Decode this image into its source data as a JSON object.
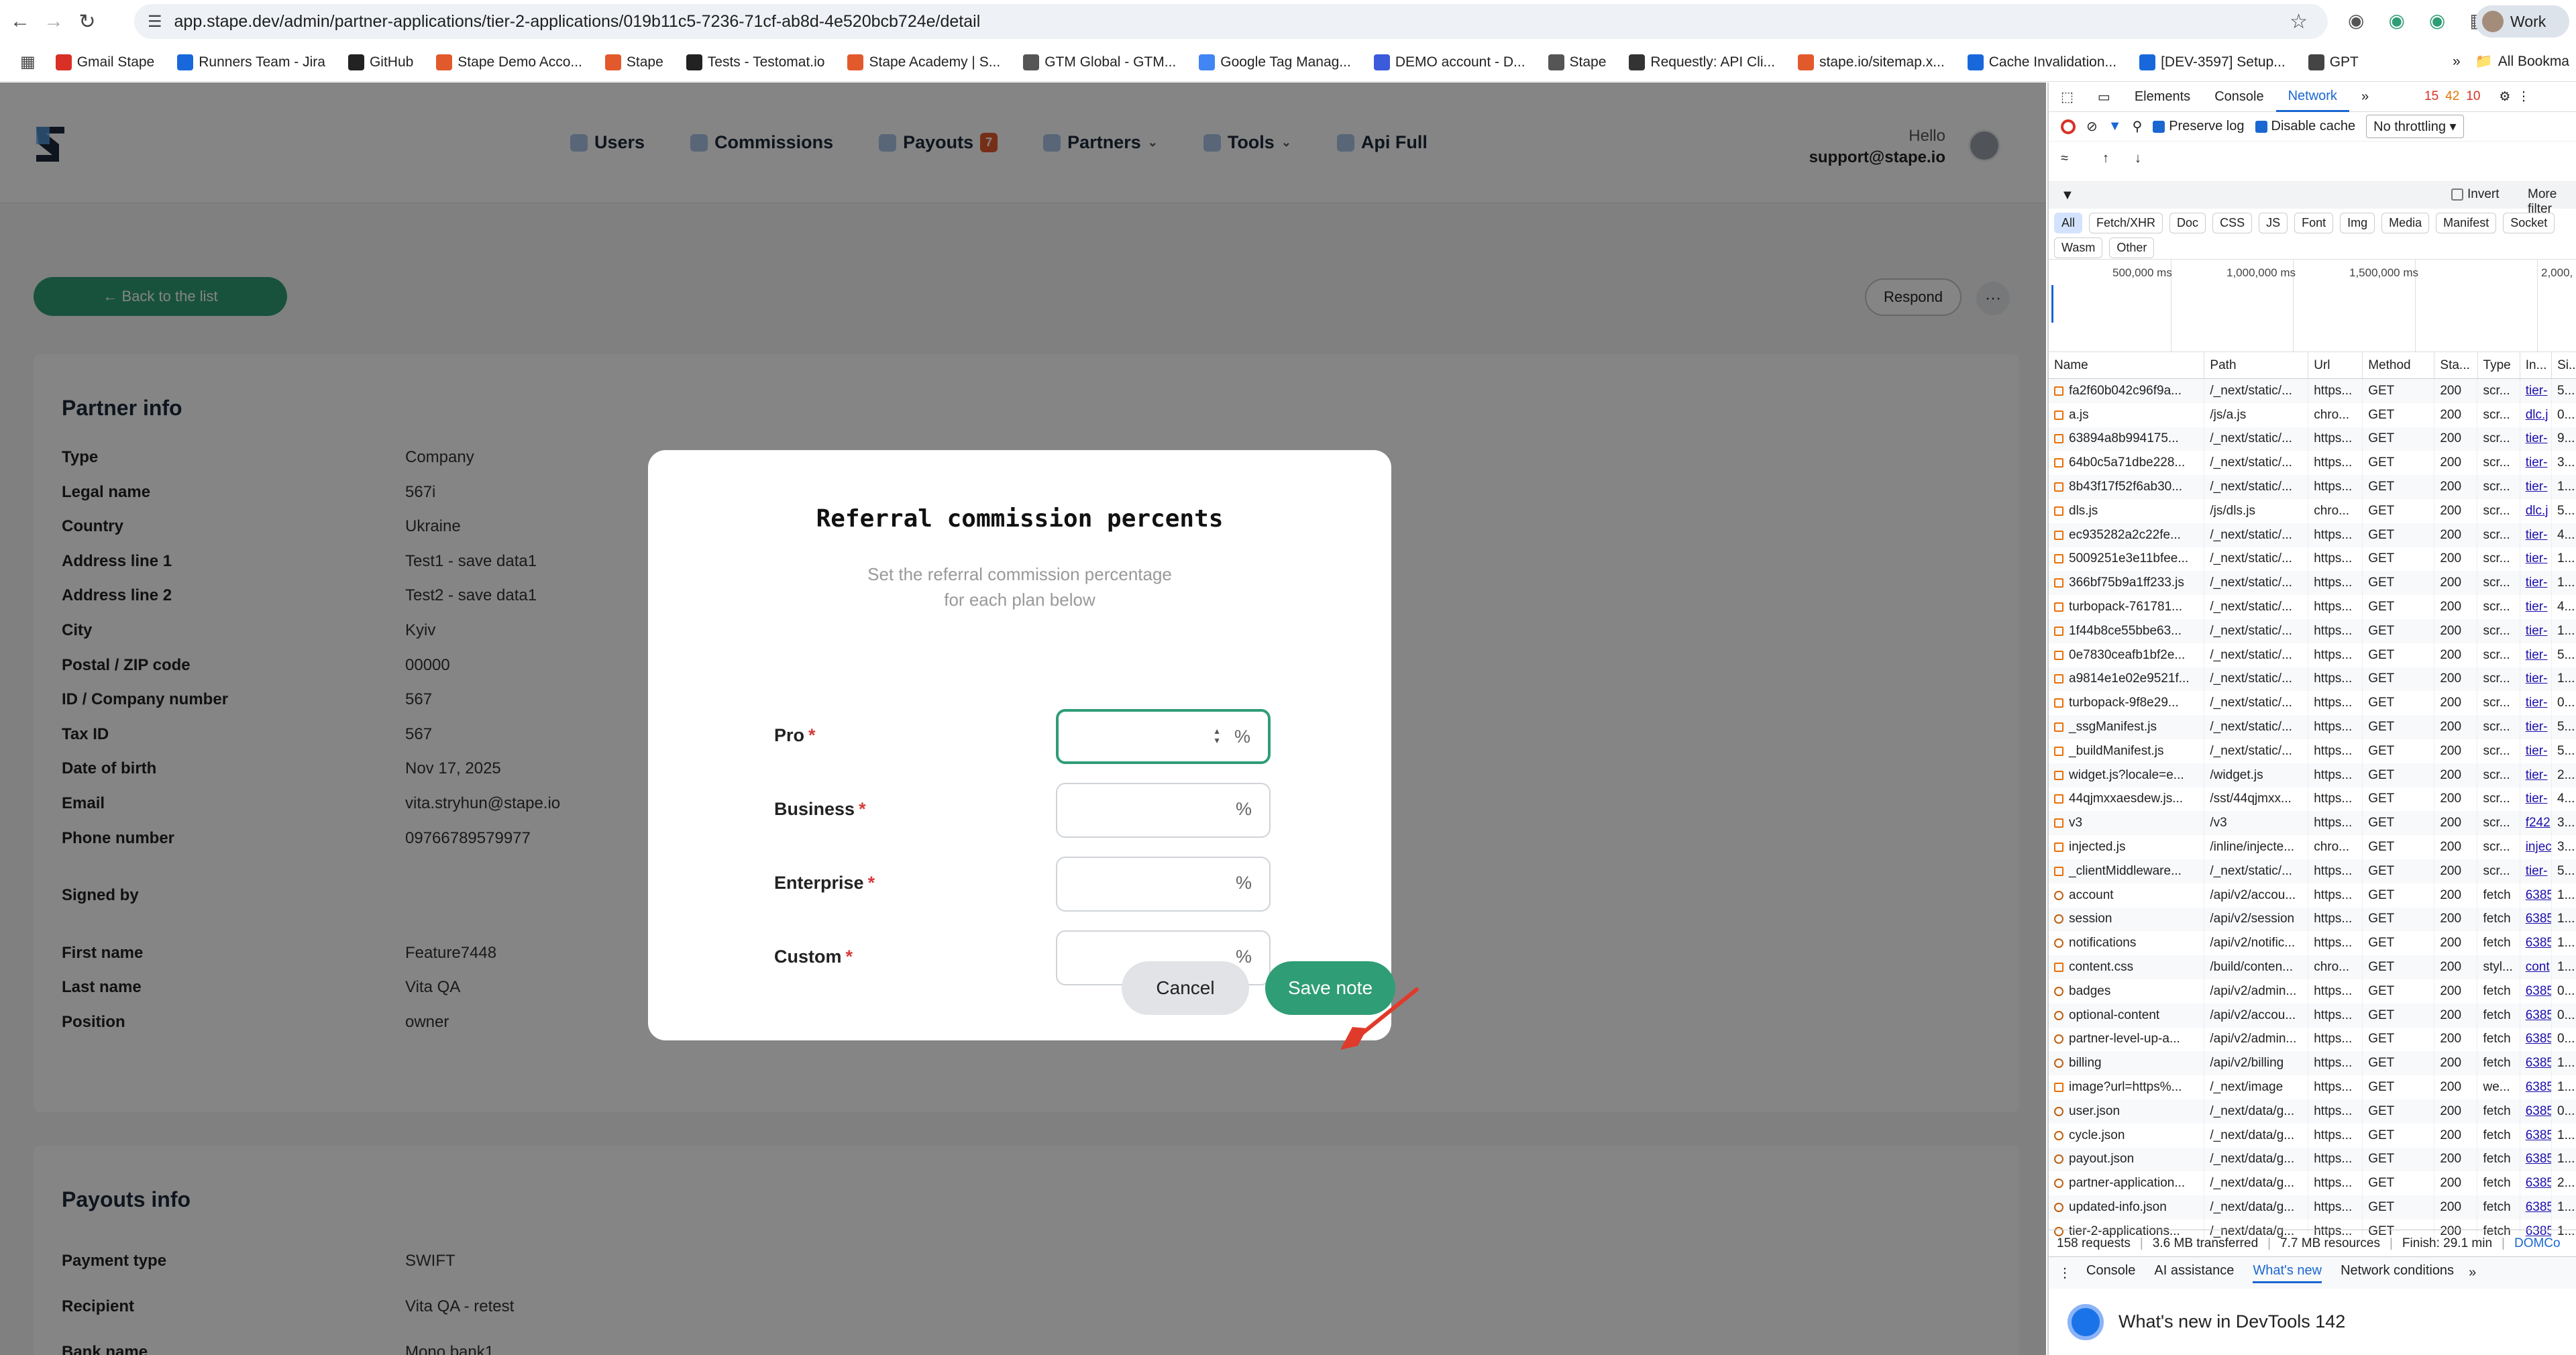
{
  "browser": {
    "url": "app.stape.dev/admin/partner-applications/tier-2-applications/019b11c5-7236-71cf-ab8d-4e520bcb724e/detail",
    "profile": "Work",
    "bookmarks": [
      {
        "label": "Gmail Stape",
        "icon": "gmail-icon",
        "color": "#d93025"
      },
      {
        "label": "Runners Team - Jira",
        "icon": "jira-icon",
        "color": "#1868db"
      },
      {
        "label": "GitHub",
        "icon": "github-icon",
        "color": "#222222"
      },
      {
        "label": "Stape Demo Acco...",
        "icon": "stape-icon",
        "color": "#e25a2c"
      },
      {
        "label": "Stape",
        "icon": "stape-icon",
        "color": "#e25a2c"
      },
      {
        "label": "Tests - Testomat.io",
        "icon": "testomat-icon",
        "color": "#222222"
      },
      {
        "label": "Stape Academy | S...",
        "icon": "stape-icon",
        "color": "#e25a2c"
      },
      {
        "label": "GTM Global - GTM...",
        "icon": "globe-icon",
        "color": "#555555"
      },
      {
        "label": "Google Tag Manag...",
        "icon": "gtm-icon",
        "color": "#4285f4"
      },
      {
        "label": "DEMO account - D...",
        "icon": "demo-icon",
        "color": "#3b5bdb"
      },
      {
        "label": "Stape",
        "icon": "globe-icon",
        "color": "#555555"
      },
      {
        "label": "Requestly: API Cli...",
        "icon": "requestly-icon",
        "color": "#333333"
      },
      {
        "label": "stape.io/sitemap.x...",
        "icon": "stape-icon",
        "color": "#e25a2c"
      },
      {
        "label": "Cache Invalidation...",
        "icon": "cache-icon",
        "color": "#1868db"
      },
      {
        "label": "[DEV-3597] Setup...",
        "icon": "jira-icon",
        "color": "#1868db"
      },
      {
        "label": "GPT",
        "icon": "gpt-icon",
        "color": "#444444"
      }
    ],
    "all_bookmarks": "All Bookma"
  },
  "app": {
    "nav": [
      {
        "label": "Users",
        "dropdown": false
      },
      {
        "label": "Commissions",
        "dropdown": false
      },
      {
        "label": "Payouts",
        "badge": "7",
        "dropdown": false
      },
      {
        "label": "Partners",
        "dropdown": true
      },
      {
        "label": "Tools",
        "dropdown": true
      },
      {
        "label": "Api Full",
        "dropdown": false
      }
    ],
    "hello": "Hello",
    "user_email": "support@stape.io",
    "back_label": "← Back to the list",
    "respond_label": "Respond",
    "more_label": "···"
  },
  "partner_info": {
    "title": "Partner info",
    "rows": [
      {
        "label": "Type",
        "value": "Company"
      },
      {
        "label": "Legal name",
        "value": "567i"
      },
      {
        "label": "Country",
        "value": "Ukraine"
      },
      {
        "label": "Address line 1",
        "value": "Test1 - save data1"
      },
      {
        "label": "Address line 2",
        "value": "Test2 - save data1"
      },
      {
        "label": "City",
        "value": "Kyiv"
      },
      {
        "label": "Postal / ZIP code",
        "value": "00000"
      },
      {
        "label": "ID / Company number",
        "value": "567"
      },
      {
        "label": "Tax ID",
        "value": "567"
      },
      {
        "label": "Date of birth",
        "value": "Nov 17, 2025"
      },
      {
        "label": "Email",
        "value": "vita.stryhun@stape.io"
      },
      {
        "label": "Phone number",
        "value": "09766789579977"
      },
      {
        "label": "Signed by",
        "value": ""
      },
      {
        "label": "First name",
        "value": "Feature7448"
      },
      {
        "label": "Last name",
        "value": "Vita QA"
      },
      {
        "label": "Position",
        "value": "owner"
      }
    ]
  },
  "payouts_info": {
    "title": "Payouts info",
    "rows": [
      {
        "label": "Payment type",
        "value": "SWIFT"
      },
      {
        "label": "Recipient",
        "value": "Vita QA - retest"
      },
      {
        "label": "Bank name",
        "value": "Mono bank1"
      }
    ]
  },
  "modal": {
    "title": "Referral commission percents",
    "subtitle_line1": "Set the referral commission percentage",
    "subtitle_line2": "for each plan below",
    "fields": [
      {
        "label": "Pro",
        "value": "",
        "unit": "%",
        "focused": true
      },
      {
        "label": "Business",
        "value": "",
        "unit": "%",
        "focused": false
      },
      {
        "label": "Enterprise",
        "value": "",
        "unit": "%",
        "focused": false
      },
      {
        "label": "Custom",
        "value": "",
        "unit": "%",
        "focused": false
      }
    ],
    "required_mark": "*",
    "cancel_label": "Cancel",
    "save_label": "Save note"
  },
  "devtools": {
    "tabs": [
      "Elements",
      "Console",
      "Network"
    ],
    "active_tab": "Network",
    "errors": "15",
    "warnings": "42",
    "issues": "10",
    "preserve_log": "Preserve log",
    "disable_cache": "Disable cache",
    "throttling": "No throttling",
    "invert": "Invert",
    "more_filters": "More filter",
    "type_filters": [
      "All",
      "Fetch/XHR",
      "Doc",
      "CSS",
      "JS",
      "Font",
      "Img",
      "Media",
      "Manifest",
      "Socket",
      "Wasm",
      "Other"
    ],
    "timeline_labels": [
      "500,000 ms",
      "1,000,000 ms",
      "1,500,000 ms",
      "2,000,"
    ],
    "columns": [
      "Name",
      "Path",
      "Url",
      "Method",
      "Sta...",
      "Type",
      "In...",
      "Si..."
    ],
    "requests": [
      [
        "fa2f60b042c96f9a...",
        "/_next/static/...",
        "https...",
        "GET",
        "200",
        "scr...",
        "tier-",
        "5..."
      ],
      [
        "a.js",
        "/js/a.js",
        "chro...",
        "GET",
        "200",
        "scr...",
        "dlc.j",
        "0..."
      ],
      [
        "63894a8b994175...",
        "/_next/static/...",
        "https...",
        "GET",
        "200",
        "scr...",
        "tier-",
        "9..."
      ],
      [
        "64b0c5a71dbe228...",
        "/_next/static/...",
        "https...",
        "GET",
        "200",
        "scr...",
        "tier-",
        "3..."
      ],
      [
        "8b43f17f52f6ab30...",
        "/_next/static/...",
        "https...",
        "GET",
        "200",
        "scr...",
        "tier-",
        "1..."
      ],
      [
        "dls.js",
        "/js/dls.js",
        "chro...",
        "GET",
        "200",
        "scr...",
        "dlc.j",
        "5..."
      ],
      [
        "ec935282a2c22fe...",
        "/_next/static/...",
        "https...",
        "GET",
        "200",
        "scr...",
        "tier-",
        "4..."
      ],
      [
        "5009251e3e11bfee...",
        "/_next/static/...",
        "https...",
        "GET",
        "200",
        "scr...",
        "tier-",
        "1..."
      ],
      [
        "366bf75b9a1ff233.js",
        "/_next/static/...",
        "https...",
        "GET",
        "200",
        "scr...",
        "tier-",
        "1..."
      ],
      [
        "turbopack-761781...",
        "/_next/static/...",
        "https...",
        "GET",
        "200",
        "scr...",
        "tier-",
        "4..."
      ],
      [
        "1f44b8ce55bbe63...",
        "/_next/static/...",
        "https...",
        "GET",
        "200",
        "scr...",
        "tier-",
        "1..."
      ],
      [
        "0e7830ceafb1bf2e...",
        "/_next/static/...",
        "https...",
        "GET",
        "200",
        "scr...",
        "tier-",
        "5..."
      ],
      [
        "a9814e1e02e9521f...",
        "/_next/static/...",
        "https...",
        "GET",
        "200",
        "scr...",
        "tier-",
        "1..."
      ],
      [
        "turbopack-9f8e29...",
        "/_next/static/...",
        "https...",
        "GET",
        "200",
        "scr...",
        "tier-",
        "0..."
      ],
      [
        "_ssgManifest.js",
        "/_next/static/...",
        "https...",
        "GET",
        "200",
        "scr...",
        "tier-",
        "5..."
      ],
      [
        "_buildManifest.js",
        "/_next/static/...",
        "https...",
        "GET",
        "200",
        "scr...",
        "tier-",
        "5..."
      ],
      [
        "widget.js?locale=e...",
        "/widget.js",
        "https...",
        "GET",
        "200",
        "scr...",
        "tier-",
        "2..."
      ],
      [
        "44qjmxxaesdew.js...",
        "/sst/44qjmxx...",
        "https...",
        "GET",
        "200",
        "scr...",
        "tier-",
        "4..."
      ],
      [
        "v3",
        "/v3",
        "https...",
        "GET",
        "200",
        "scr...",
        "f242",
        "3..."
      ],
      [
        "injected.js",
        "/inline/injecte...",
        "chro...",
        "GET",
        "200",
        "scr...",
        "injec",
        "3..."
      ],
      [
        "_clientMiddleware...",
        "/_next/static/...",
        "https...",
        "GET",
        "200",
        "scr...",
        "tier-",
        "5..."
      ],
      [
        "account",
        "/api/v2/accou...",
        "https...",
        "GET",
        "200",
        "fetch",
        "6385",
        "1..."
      ],
      [
        "session",
        "/api/v2/session",
        "https...",
        "GET",
        "200",
        "fetch",
        "6385",
        "1..."
      ],
      [
        "notifications",
        "/api/v2/notific...",
        "https...",
        "GET",
        "200",
        "fetch",
        "6385",
        "1..."
      ],
      [
        "content.css",
        "/build/conten...",
        "chro...",
        "GET",
        "200",
        "styl...",
        "cont",
        "1..."
      ],
      [
        "badges",
        "/api/v2/admin...",
        "https...",
        "GET",
        "200",
        "fetch",
        "6385",
        "0..."
      ],
      [
        "optional-content",
        "/api/v2/accou...",
        "https...",
        "GET",
        "200",
        "fetch",
        "6385",
        "0..."
      ],
      [
        "partner-level-up-a...",
        "/api/v2/admin...",
        "https...",
        "GET",
        "200",
        "fetch",
        "6385",
        "0..."
      ],
      [
        "billing",
        "/api/v2/billing",
        "https...",
        "GET",
        "200",
        "fetch",
        "6385",
        "1..."
      ],
      [
        "image?url=https%...",
        "/_next/image",
        "https...",
        "GET",
        "200",
        "we...",
        "6385",
        "1..."
      ],
      [
        "user.json",
        "/_next/data/g...",
        "https...",
        "GET",
        "200",
        "fetch",
        "6385",
        "0..."
      ],
      [
        "cycle.json",
        "/_next/data/g...",
        "https...",
        "GET",
        "200",
        "fetch",
        "6385",
        "1..."
      ],
      [
        "payout.json",
        "/_next/data/g...",
        "https...",
        "GET",
        "200",
        "fetch",
        "6385",
        "1..."
      ],
      [
        "partner-application...",
        "/_next/data/g...",
        "https...",
        "GET",
        "200",
        "fetch",
        "6385",
        "2..."
      ],
      [
        "updated-info.json",
        "/_next/data/g...",
        "https...",
        "GET",
        "200",
        "fetch",
        "6385",
        "1..."
      ],
      [
        "tier-2-applications...",
        "/_next/data/g...",
        "https...",
        "GET",
        "200",
        "fetch",
        "6385",
        "1..."
      ]
    ],
    "status_requests": "158 requests",
    "status_transferred": "3.6 MB transferred",
    "status_resources": "7.7 MB resources",
    "status_finish": "Finish: 29.1 min",
    "status_dom": "DOMCo",
    "drawer_tabs": [
      "Console",
      "AI assistance",
      "What's new",
      "Network conditions"
    ],
    "drawer_active": "What's new",
    "whats_new": "What's new in DevTools 142"
  }
}
